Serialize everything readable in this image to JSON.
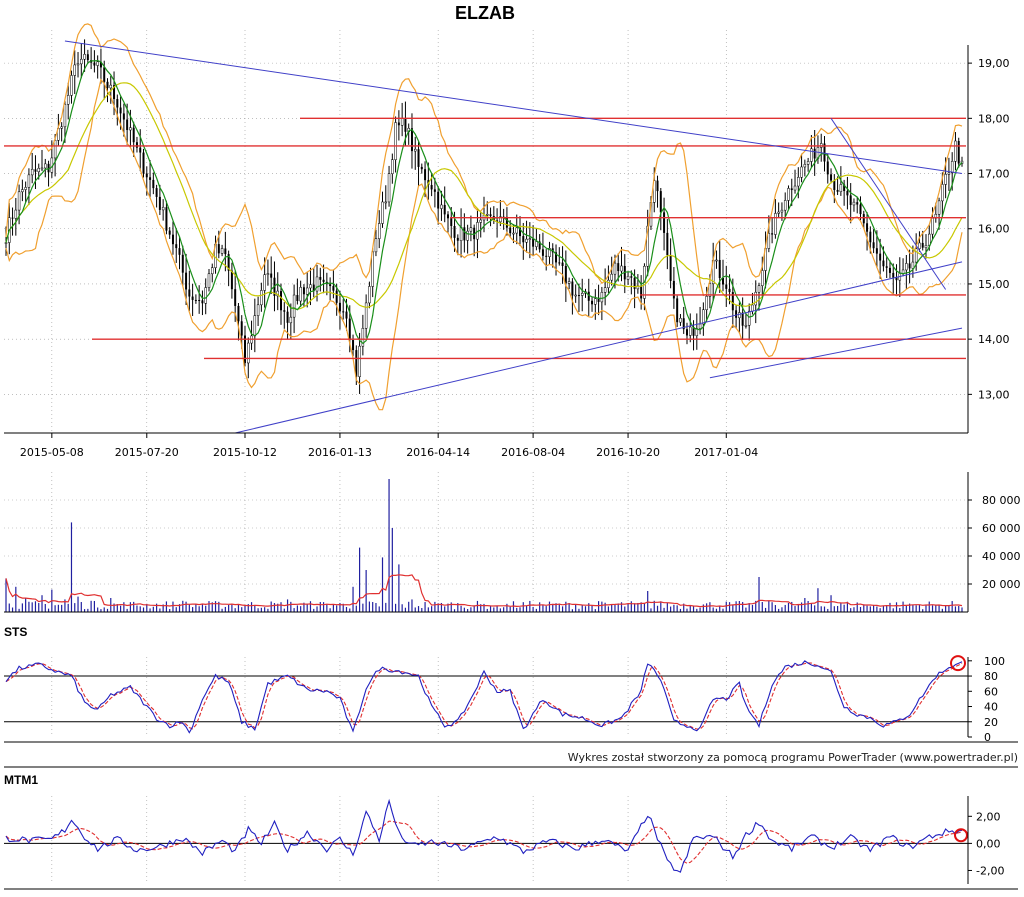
{
  "chart_data": [
    {
      "type": "candlestick",
      "title": "ELZAB",
      "x_tick_labels": [
        "2015-05-08",
        "2015-07-20",
        "2015-10-12",
        "2016-01-13",
        "2016-04-14",
        "2016-08-04",
        "2016-10-20",
        "2017-01-04"
      ],
      "y_tick_labels": [
        "13,00",
        "14,00",
        "15,00",
        "16,00",
        "17,00",
        "18,00",
        "19,00"
      ],
      "ylim": [
        12.3,
        19.6
      ],
      "price_path": [
        [
          0,
          15.9
        ],
        [
          4,
          16.6
        ],
        [
          8,
          17.0
        ],
        [
          13,
          17.1
        ],
        [
          18,
          18.2
        ],
        [
          22,
          19.1
        ],
        [
          28,
          18.9
        ],
        [
          34,
          18.3
        ],
        [
          40,
          17.4
        ],
        [
          46,
          16.6
        ],
        [
          52,
          15.6
        ],
        [
          56,
          14.8
        ],
        [
          60,
          14.7
        ],
        [
          64,
          15.6
        ],
        [
          67,
          15.5
        ],
        [
          70,
          14.6
        ],
        [
          73,
          13.6
        ],
        [
          76,
          14.4
        ],
        [
          79,
          15.2
        ],
        [
          82,
          14.9
        ],
        [
          86,
          14.4
        ],
        [
          90,
          14.9
        ],
        [
          95,
          15.0
        ],
        [
          100,
          14.8
        ],
        [
          104,
          14.5
        ],
        [
          107,
          13.4
        ],
        [
          110,
          14.6
        ],
        [
          113,
          15.9
        ],
        [
          116,
          16.6
        ],
        [
          119,
          17.8
        ],
        [
          122,
          17.9
        ],
        [
          126,
          17.1
        ],
        [
          130,
          16.8
        ],
        [
          134,
          16.2
        ],
        [
          138,
          15.9
        ],
        [
          142,
          15.9
        ],
        [
          146,
          16.1
        ],
        [
          150,
          16.2
        ],
        [
          154,
          16.0
        ],
        [
          158,
          15.8
        ],
        [
          162,
          15.7
        ],
        [
          166,
          15.5
        ],
        [
          170,
          15.2
        ],
        [
          174,
          14.8
        ],
        [
          178,
          14.7
        ],
        [
          182,
          14.8
        ],
        [
          186,
          15.3
        ],
        [
          190,
          15.2
        ],
        [
          194,
          14.8
        ],
        [
          196,
          16.0
        ],
        [
          198,
          17.0
        ],
        [
          201,
          15.8
        ],
        [
          204,
          14.6
        ],
        [
          208,
          14.0
        ],
        [
          212,
          14.4
        ],
        [
          216,
          15.4
        ],
        [
          220,
          15.0
        ],
        [
          223,
          14.4
        ],
        [
          226,
          14.2
        ],
        [
          230,
          15.1
        ],
        [
          234,
          16.0
        ],
        [
          238,
          16.6
        ],
        [
          242,
          17.0
        ],
        [
          246,
          17.3
        ],
        [
          249,
          17.6
        ],
        [
          252,
          16.9
        ],
        [
          256,
          16.6
        ],
        [
          260,
          16.3
        ],
        [
          264,
          15.8
        ],
        [
          268,
          15.3
        ],
        [
          272,
          15.0
        ],
        [
          276,
          15.3
        ],
        [
          280,
          15.7
        ],
        [
          284,
          16.2
        ],
        [
          287,
          16.9
        ],
        [
          290,
          17.5
        ],
        [
          292,
          17.1
        ]
      ],
      "moving_averages": [
        "green",
        "yellow-green"
      ],
      "bollinger_bands": "orange",
      "horizontal_levels": [
        18.0,
        17.5,
        16.2,
        14.8,
        14.0,
        13.65
      ],
      "trendlines": [
        {
          "from": [
            18,
            19.4
          ],
          "to": [
            292,
            17.0
          ]
        },
        {
          "from": [
            70,
            12.3
          ],
          "to": [
            292,
            15.4
          ]
        },
        {
          "from": [
            215,
            13.3
          ],
          "to": [
            292,
            14.2
          ]
        },
        {
          "from": [
            252,
            18.0
          ],
          "to": [
            287,
            14.9
          ]
        }
      ]
    },
    {
      "type": "bar",
      "title": "",
      "y_tick_labels": [
        "20 000",
        "40 000",
        "60 000",
        "80 000"
      ],
      "ylim": [
        0,
        100000
      ],
      "volume_spikes": [
        [
          0,
          24000
        ],
        [
          3,
          18000
        ],
        [
          6,
          10000
        ],
        [
          11,
          12000
        ],
        [
          14,
          16000
        ],
        [
          18,
          9000
        ],
        [
          20,
          64000
        ],
        [
          22,
          11000
        ],
        [
          26,
          8000
        ],
        [
          32,
          10000
        ],
        [
          36,
          7000
        ],
        [
          54,
          8000
        ],
        [
          60,
          6000
        ],
        [
          76,
          5000
        ],
        [
          86,
          9000
        ],
        [
          95,
          4000
        ],
        [
          106,
          18000
        ],
        [
          108,
          46000
        ],
        [
          110,
          30000
        ],
        [
          115,
          39000
        ],
        [
          117,
          95000
        ],
        [
          118,
          60000
        ],
        [
          120,
          34000
        ],
        [
          124,
          9000
        ],
        [
          134,
          4000
        ],
        [
          150,
          4000
        ],
        [
          164,
          5000
        ],
        [
          184,
          4000
        ],
        [
          196,
          15000
        ],
        [
          198,
          8000
        ],
        [
          210,
          4000
        ],
        [
          230,
          25000
        ],
        [
          234,
          7000
        ],
        [
          244,
          10000
        ],
        [
          248,
          17000
        ],
        [
          252,
          12000
        ],
        [
          264,
          4000
        ],
        [
          276,
          6000
        ],
        [
          284,
          5000
        ],
        [
          290,
          4000
        ]
      ]
    },
    {
      "type": "line",
      "title": "STS",
      "y_tick_labels": [
        "0",
        "20",
        "40",
        "60",
        "80",
        "100"
      ],
      "ylim": [
        0,
        100
      ],
      "reference_lines": [
        20,
        80
      ],
      "stoch_path": [
        [
          0,
          75
        ],
        [
          4,
          90
        ],
        [
          10,
          95
        ],
        [
          16,
          85
        ],
        [
          20,
          80
        ],
        [
          24,
          45
        ],
        [
          28,
          35
        ],
        [
          32,
          55
        ],
        [
          38,
          65
        ],
        [
          42,
          45
        ],
        [
          46,
          25
        ],
        [
          50,
          15
        ],
        [
          54,
          20
        ],
        [
          56,
          5
        ],
        [
          60,
          50
        ],
        [
          64,
          80
        ],
        [
          68,
          72
        ],
        [
          72,
          20
        ],
        [
          76,
          10
        ],
        [
          80,
          70
        ],
        [
          86,
          80
        ],
        [
          92,
          62
        ],
        [
          98,
          60
        ],
        [
          102,
          50
        ],
        [
          106,
          5
        ],
        [
          110,
          65
        ],
        [
          114,
          90
        ],
        [
          118,
          88
        ],
        [
          122,
          85
        ],
        [
          126,
          80
        ],
        [
          130,
          40
        ],
        [
          134,
          15
        ],
        [
          138,
          20
        ],
        [
          142,
          50
        ],
        [
          146,
          85
        ],
        [
          150,
          60
        ],
        [
          154,
          60
        ],
        [
          158,
          10
        ],
        [
          164,
          50
        ],
        [
          170,
          30
        ],
        [
          176,
          25
        ],
        [
          182,
          15
        ],
        [
          188,
          25
        ],
        [
          194,
          60
        ],
        [
          196,
          98
        ],
        [
          200,
          75
        ],
        [
          204,
          20
        ],
        [
          208,
          15
        ],
        [
          212,
          10
        ],
        [
          216,
          50
        ],
        [
          220,
          50
        ],
        [
          224,
          70
        ],
        [
          226,
          40
        ],
        [
          230,
          15
        ],
        [
          234,
          70
        ],
        [
          238,
          92
        ],
        [
          244,
          98
        ],
        [
          248,
          95
        ],
        [
          252,
          85
        ],
        [
          256,
          40
        ],
        [
          260,
          30
        ],
        [
          264,
          25
        ],
        [
          268,
          15
        ],
        [
          272,
          20
        ],
        [
          276,
          30
        ],
        [
          280,
          55
        ],
        [
          284,
          80
        ],
        [
          288,
          92
        ],
        [
          292,
          97
        ]
      ]
    },
    {
      "type": "line",
      "title": "MTM1",
      "y_tick_labels": [
        "-2,00",
        "0,00",
        "2,00"
      ],
      "ylim": [
        -3.0,
        3.5
      ],
      "reference_lines": [
        0
      ],
      "mtm_path": [
        [
          0,
          0.4
        ],
        [
          8,
          0.2
        ],
        [
          14,
          0.3
        ],
        [
          18,
          1.0
        ],
        [
          20,
          1.8
        ],
        [
          24,
          0.5
        ],
        [
          28,
          -0.4
        ],
        [
          34,
          0.3
        ],
        [
          40,
          -0.5
        ],
        [
          46,
          -0.3
        ],
        [
          54,
          0.4
        ],
        [
          60,
          -0.7
        ],
        [
          66,
          0.2
        ],
        [
          70,
          -0.6
        ],
        [
          74,
          1.0
        ],
        [
          78,
          0.0
        ],
        [
          82,
          1.4
        ],
        [
          86,
          -0.5
        ],
        [
          92,
          0.8
        ],
        [
          98,
          -0.4
        ],
        [
          102,
          0.3
        ],
        [
          106,
          -0.8
        ],
        [
          110,
          2.3
        ],
        [
          114,
          0.3
        ],
        [
          117,
          3.1
        ],
        [
          120,
          0.7
        ],
        [
          124,
          -0.2
        ],
        [
          130,
          0.1
        ],
        [
          140,
          -0.4
        ],
        [
          150,
          0.5
        ],
        [
          158,
          -0.6
        ],
        [
          166,
          0.2
        ],
        [
          174,
          -0.4
        ],
        [
          182,
          0.3
        ],
        [
          190,
          -0.6
        ],
        [
          196,
          2.2
        ],
        [
          198,
          1.0
        ],
        [
          202,
          -1.4
        ],
        [
          206,
          -2.2
        ],
        [
          210,
          0.4
        ],
        [
          216,
          0.5
        ],
        [
          222,
          -1.0
        ],
        [
          226,
          0.6
        ],
        [
          230,
          1.6
        ],
        [
          234,
          0.2
        ],
        [
          240,
          -0.4
        ],
        [
          246,
          0.5
        ],
        [
          252,
          -0.3
        ],
        [
          258,
          0.4
        ],
        [
          264,
          -0.5
        ],
        [
          270,
          0.5
        ],
        [
          276,
          -0.3
        ],
        [
          282,
          0.5
        ],
        [
          288,
          0.9
        ],
        [
          292,
          0.9
        ]
      ]
    }
  ],
  "footer": {
    "credit_text": "Wykres został stworzony za pomocą programu PowerTrader (www.powertrader.pl)"
  }
}
